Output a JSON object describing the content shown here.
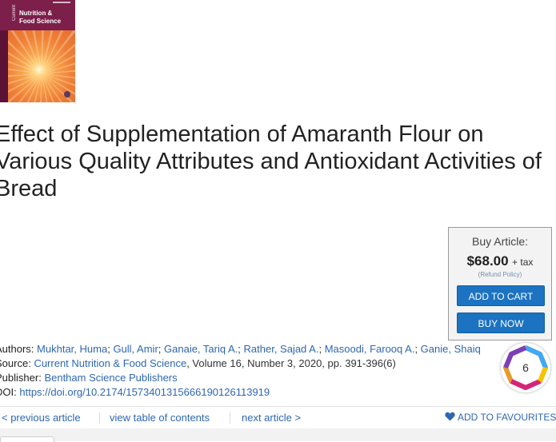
{
  "cover": {
    "journal_line1": "Nutrition &",
    "journal_line2": "Food Science",
    "journal_side": "Current"
  },
  "article": {
    "title": "Effect of Supplementation of Amaranth Flour on Various Quality Attributes and Antioxidant Activities of Bread"
  },
  "purchase": {
    "label": "Buy Article:",
    "price": "$68.00",
    "tax": "+ tax",
    "refund": "(Refund Policy)",
    "add_to_cart": "ADD TO CART",
    "buy_now": "BUY NOW",
    "button_color": "#1b73c1"
  },
  "meta": {
    "authors_label": "Authors:",
    "authors": [
      "Mukhtar, Huma",
      "Gull, Amir",
      "Ganaie, Tariq A.",
      "Rather, Sajad A.",
      "Masoodi, Farooq A.",
      "Ganie, Shaiq"
    ],
    "authors_sep": "; ",
    "source_label": "Source:",
    "source_journal": "Current Nutrition & Food Science",
    "source_details": ", Volume 16, Number 3, 2020, pp. 391-396(6)",
    "publisher_label": "Publisher:",
    "publisher": "Bentham Science Publishers",
    "doi_label": "DOI:",
    "doi": "https://doi.org/10.2174/1573401315666190126113919"
  },
  "altmetric": {
    "count": "6",
    "icon": "altmetric-donut-icon"
  },
  "nav": {
    "prev": "< previous article",
    "toc": "view table of contents",
    "next": "next article >",
    "favourites": "ADD TO FAVOURITES",
    "favourites_icon": "heart-icon",
    "link_color": "#2e67b1"
  }
}
